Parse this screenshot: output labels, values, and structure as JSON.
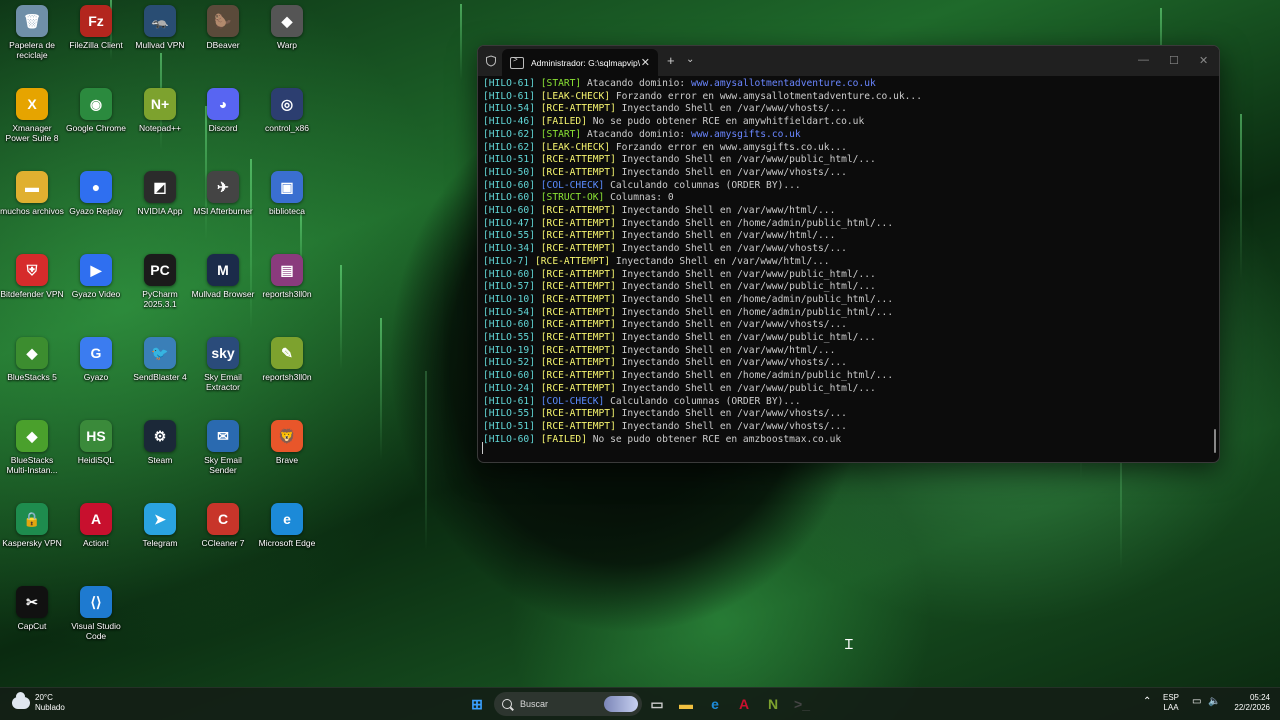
{
  "desktop": {
    "icons": [
      {
        "label": "Papelera de reciclaje",
        "icon": "recycle-bin-icon",
        "color": "#6f8fa8",
        "glyph": "🗑"
      },
      {
        "label": "FileZilla Client",
        "icon": "filezilla-icon",
        "color": "#b3261e",
        "glyph": "Fz"
      },
      {
        "label": "Mullvad VPN",
        "icon": "mullvad-icon",
        "color": "#294d73",
        "glyph": "🦡"
      },
      {
        "label": "DBeaver",
        "icon": "dbeaver-icon",
        "color": "#5a4a3a",
        "glyph": "🦫"
      },
      {
        "label": "Warp",
        "icon": "warp-icon",
        "color": "#555555",
        "glyph": "◆"
      },
      {
        "label": "Xmanager Power Suite 8",
        "icon": "xmanager-icon",
        "color": "#e6a400",
        "glyph": "X"
      },
      {
        "label": "Google Chrome",
        "icon": "chrome-icon",
        "color": "#2b8a3e",
        "glyph": "◉"
      },
      {
        "label": "Notepad++",
        "icon": "notepadpp-icon",
        "color": "#7da22e",
        "glyph": "N+"
      },
      {
        "label": "Discord",
        "icon": "discord-icon",
        "color": "#5865f2",
        "glyph": "◕"
      },
      {
        "label": "control_x86",
        "icon": "control-icon",
        "color": "#2c3e70",
        "glyph": "◎"
      },
      {
        "label": "muchos archivos",
        "icon": "folder-icon",
        "color": "#e0b030",
        "glyph": "▬"
      },
      {
        "label": "Gyazo Replay",
        "icon": "gyazo-replay-icon",
        "color": "#2f6ff0",
        "glyph": "●"
      },
      {
        "label": "NVIDIA App",
        "icon": "nvidia-icon",
        "color": "#2b2b2b",
        "glyph": "◩"
      },
      {
        "label": "MSI Afterburner",
        "icon": "msi-afterburner-icon",
        "color": "#444444",
        "glyph": "✈"
      },
      {
        "label": "biblioteca",
        "icon": "library-icon",
        "color": "#3a6fd0",
        "glyph": "▣"
      },
      {
        "label": "Bitdefender VPN",
        "icon": "bitdefender-icon",
        "color": "#d62b2b",
        "glyph": "⛨"
      },
      {
        "label": "Gyazo Video",
        "icon": "gyazo-video-icon",
        "color": "#2f6ff0",
        "glyph": "▶"
      },
      {
        "label": "PyCharm 2025.3.1",
        "icon": "pycharm-icon",
        "color": "#1b1b1b",
        "glyph": "PC"
      },
      {
        "label": "Mullvad Browser",
        "icon": "mullvad-browser-icon",
        "color": "#1b2b4a",
        "glyph": "M"
      },
      {
        "label": "reportsh3ll0n",
        "icon": "winrar-icon",
        "color": "#8a3b7d",
        "glyph": "▤"
      },
      {
        "label": "BlueStacks 5",
        "icon": "bluestacks-icon",
        "color": "#3c8d2f",
        "glyph": "◆"
      },
      {
        "label": "Gyazo",
        "icon": "gyazo-icon",
        "color": "#3b7cf0",
        "glyph": "G"
      },
      {
        "label": "SendBlaster 4",
        "icon": "sendblaster-icon",
        "color": "#3a7fb8",
        "glyph": "🐦"
      },
      {
        "label": "Sky Email Extractor",
        "icon": "sky-email-extractor-icon",
        "color": "#2a4b7a",
        "glyph": "sky"
      },
      {
        "label": "reportsh3ll0n",
        "icon": "notepad-icon",
        "color": "#7da22e",
        "glyph": "✎"
      },
      {
        "label": "BlueStacks Multi-Instan...",
        "icon": "bluestacks-multi-icon",
        "color": "#4aa02c",
        "glyph": "◆"
      },
      {
        "label": "HeidiSQL",
        "icon": "heidisql-icon",
        "color": "#3a8a3a",
        "glyph": "HS"
      },
      {
        "label": "Steam",
        "icon": "steam-icon",
        "color": "#1b2838",
        "glyph": "⚙"
      },
      {
        "label": "Sky Email Sender",
        "icon": "sky-email-sender-icon",
        "color": "#2a6ab0",
        "glyph": "✉"
      },
      {
        "label": "Brave",
        "icon": "brave-icon",
        "color": "#e8562a",
        "glyph": "🦁"
      },
      {
        "label": "Kaspersky VPN",
        "icon": "kaspersky-icon",
        "color": "#1e8c4e",
        "glyph": "🔒"
      },
      {
        "label": "Action!",
        "icon": "action-icon",
        "color": "#c8102e",
        "glyph": "A"
      },
      {
        "label": "Telegram",
        "icon": "telegram-icon",
        "color": "#2aa3e0",
        "glyph": "➤"
      },
      {
        "label": "CCleaner 7",
        "icon": "ccleaner-icon",
        "color": "#c8352a",
        "glyph": "C"
      },
      {
        "label": "Microsoft Edge",
        "icon": "edge-icon",
        "color": "#1c8ad8",
        "glyph": "e"
      },
      {
        "label": "CapCut",
        "icon": "capcut-icon",
        "color": "#111111",
        "glyph": "✂"
      },
      {
        "label": "Visual Studio Code",
        "icon": "vscode-icon",
        "color": "#1e7ad0",
        "glyph": "⟨⟩"
      }
    ]
  },
  "terminal": {
    "tab_title": "Administrador: G:\\sqlmapvip\\",
    "lines": [
      {
        "thread": "[HILO-61]",
        "tag": "[START]",
        "tclass": "t-start",
        "msg": " Atacando dominio: ",
        "domain": "www.amysallotmentadventure.co.uk"
      },
      {
        "thread": "[HILO-61]",
        "tag": "[LEAK-CHECK]",
        "tclass": "t-leak",
        "msg": " Forzando error en www.amysallotmentadventure.co.uk...",
        "domain": ""
      },
      {
        "thread": "[HILO-54]",
        "tag": "[RCE-ATTEMPT]",
        "tclass": "t-rce",
        "msg": " Inyectando Shell en /var/www/vhosts/...",
        "domain": ""
      },
      {
        "thread": "[HILO-46]",
        "tag": "[FAILED]",
        "tclass": "t-fail",
        "msg": " No se pudo obtener RCE en amywhitfieldart.co.uk",
        "domain": ""
      },
      {
        "thread": "[HILO-62]",
        "tag": "[START]",
        "tclass": "t-start",
        "msg": " Atacando dominio: ",
        "domain": "www.amysgifts.co.uk"
      },
      {
        "thread": "[HILO-62]",
        "tag": "[LEAK-CHECK]",
        "tclass": "t-leak",
        "msg": " Forzando error en www.amysgifts.co.uk...",
        "domain": ""
      },
      {
        "thread": "[HILO-51]",
        "tag": "[RCE-ATTEMPT]",
        "tclass": "t-rce",
        "msg": " Inyectando Shell en /var/www/public_html/...",
        "domain": ""
      },
      {
        "thread": "[HILO-50]",
        "tag": "[RCE-ATTEMPT]",
        "tclass": "t-rce",
        "msg": " Inyectando Shell en /var/www/vhosts/...",
        "domain": ""
      },
      {
        "thread": "[HILO-60]",
        "tag": "[COL-CHECK]",
        "tclass": "t-col",
        "msg": " Calculando columnas (ORDER BY)...",
        "domain": ""
      },
      {
        "thread": "[HILO-60]",
        "tag": "[STRUCT-OK]",
        "tclass": "t-struct",
        "msg": " Columnas: 0",
        "domain": ""
      },
      {
        "thread": "[HILO-60]",
        "tag": "[RCE-ATTEMPT]",
        "tclass": "t-rce",
        "msg": " Inyectando Shell en /var/www/html/...",
        "domain": ""
      },
      {
        "thread": "[HILO-47]",
        "tag": "[RCE-ATTEMPT]",
        "tclass": "t-rce",
        "msg": " Inyectando Shell en /home/admin/public_html/...",
        "domain": ""
      },
      {
        "thread": "[HILO-55]",
        "tag": "[RCE-ATTEMPT]",
        "tclass": "t-rce",
        "msg": " Inyectando Shell en /var/www/html/...",
        "domain": ""
      },
      {
        "thread": "[HILO-34]",
        "tag": "[RCE-ATTEMPT]",
        "tclass": "t-rce",
        "msg": " Inyectando Shell en /var/www/vhosts/...",
        "domain": ""
      },
      {
        "thread": "[HILO-7]",
        "tag": "[RCE-ATTEMPT]",
        "tclass": "t-rce",
        "msg": " Inyectando Shell en /var/www/html/...",
        "domain": ""
      },
      {
        "thread": "[HILO-60]",
        "tag": "[RCE-ATTEMPT]",
        "tclass": "t-rce",
        "msg": " Inyectando Shell en /var/www/public_html/...",
        "domain": ""
      },
      {
        "thread": "[HILO-57]",
        "tag": "[RCE-ATTEMPT]",
        "tclass": "t-rce",
        "msg": " Inyectando Shell en /var/www/public_html/...",
        "domain": ""
      },
      {
        "thread": "[HILO-10]",
        "tag": "[RCE-ATTEMPT]",
        "tclass": "t-rce",
        "msg": " Inyectando Shell en /home/admin/public_html/...",
        "domain": ""
      },
      {
        "thread": "[HILO-54]",
        "tag": "[RCE-ATTEMPT]",
        "tclass": "t-rce",
        "msg": " Inyectando Shell en /home/admin/public_html/...",
        "domain": ""
      },
      {
        "thread": "[HILO-60]",
        "tag": "[RCE-ATTEMPT]",
        "tclass": "t-rce",
        "msg": " Inyectando Shell en /var/www/vhosts/...",
        "domain": ""
      },
      {
        "thread": "[HILO-55]",
        "tag": "[RCE-ATTEMPT]",
        "tclass": "t-rce",
        "msg": " Inyectando Shell en /var/www/public_html/...",
        "domain": ""
      },
      {
        "thread": "[HILO-19]",
        "tag": "[RCE-ATTEMPT]",
        "tclass": "t-rce",
        "msg": " Inyectando Shell en /var/www/html/...",
        "domain": ""
      },
      {
        "thread": "[HILO-52]",
        "tag": "[RCE-ATTEMPT]",
        "tclass": "t-rce",
        "msg": " Inyectando Shell en /var/www/vhosts/...",
        "domain": ""
      },
      {
        "thread": "[HILO-60]",
        "tag": "[RCE-ATTEMPT]",
        "tclass": "t-rce",
        "msg": " Inyectando Shell en /home/admin/public_html/...",
        "domain": ""
      },
      {
        "thread": "[HILO-24]",
        "tag": "[RCE-ATTEMPT]",
        "tclass": "t-rce",
        "msg": " Inyectando Shell en /var/www/public_html/...",
        "domain": ""
      },
      {
        "thread": "[HILO-61]",
        "tag": "[COL-CHECK]",
        "tclass": "t-col",
        "msg": " Calculando columnas (ORDER BY)...",
        "domain": ""
      },
      {
        "thread": "[HILO-55]",
        "tag": "[RCE-ATTEMPT]",
        "tclass": "t-rce",
        "msg": " Inyectando Shell en /var/www/vhosts/...",
        "domain": ""
      },
      {
        "thread": "[HILO-51]",
        "tag": "[RCE-ATTEMPT]",
        "tclass": "t-rce",
        "msg": " Inyectando Shell en /var/www/vhosts/...",
        "domain": ""
      },
      {
        "thread": "[HILO-60]",
        "tag": "[FAILED]",
        "tclass": "t-fail",
        "msg": " No se pudo obtener RCE en amzboostmax.co.uk",
        "domain": ""
      }
    ]
  },
  "taskbar": {
    "weather_temp": "20°C",
    "weather_desc": "Nublado",
    "search_placeholder": "Buscar",
    "lang_top": "ESP",
    "lang_bottom": "LAA",
    "time": "05:24",
    "date": "22/2/2026",
    "apps": [
      {
        "icon": "start-icon",
        "color": "#3aa0ff",
        "glyph": "⊞"
      },
      {
        "icon": "task-view-icon",
        "color": "#cccccc",
        "glyph": "▭"
      },
      {
        "icon": "file-explorer-icon",
        "color": "#f0c040",
        "glyph": "▬"
      },
      {
        "icon": "edge-icon",
        "color": "#1c8ad8",
        "glyph": "e"
      },
      {
        "icon": "action-icon",
        "color": "#c8102e",
        "glyph": "A"
      },
      {
        "icon": "notepadpp-icon",
        "color": "#7da22e",
        "glyph": "N"
      },
      {
        "icon": "terminal-icon",
        "color": "#444444",
        "glyph": ">_"
      }
    ]
  }
}
